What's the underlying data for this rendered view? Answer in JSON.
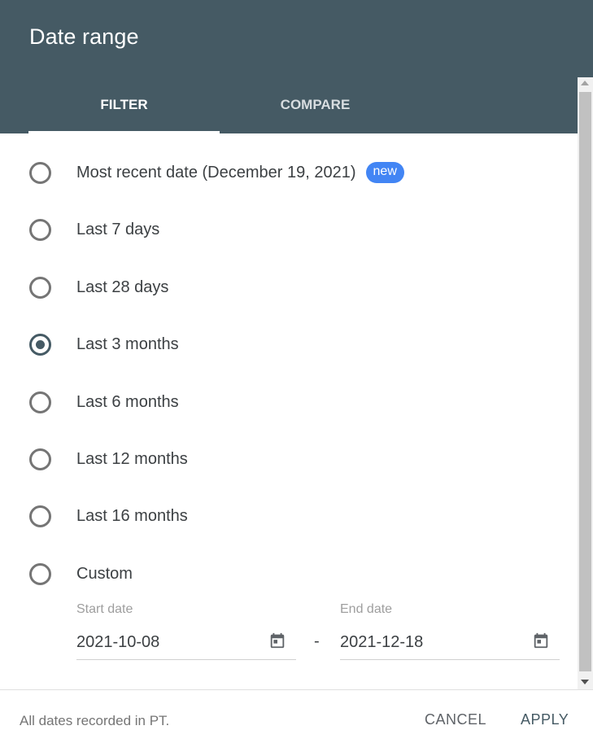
{
  "dialog": {
    "title": "Date range",
    "tabs": [
      {
        "label": "FILTER",
        "active": true
      },
      {
        "label": "COMPARE",
        "active": false
      }
    ]
  },
  "options": [
    {
      "label": "Most recent date (December 19, 2021)",
      "badge": "new",
      "selected": false
    },
    {
      "label": "Last 7 days",
      "selected": false
    },
    {
      "label": "Last 28 days",
      "selected": false
    },
    {
      "label": "Last 3 months",
      "selected": true
    },
    {
      "label": "Last 6 months",
      "selected": false
    },
    {
      "label": "Last 12 months",
      "selected": false
    },
    {
      "label": "Last 16 months",
      "selected": false
    },
    {
      "label": "Custom",
      "selected": false
    }
  ],
  "custom": {
    "start_label": "Start date",
    "start_value": "2021-10-08",
    "separator": "-",
    "end_label": "End date",
    "end_value": "2021-12-18"
  },
  "footer": {
    "note": "All dates recorded in PT.",
    "cancel_label": "CANCEL",
    "apply_label": "APPLY"
  },
  "colors": {
    "header": "#455a64",
    "badge": "#4285f4"
  }
}
